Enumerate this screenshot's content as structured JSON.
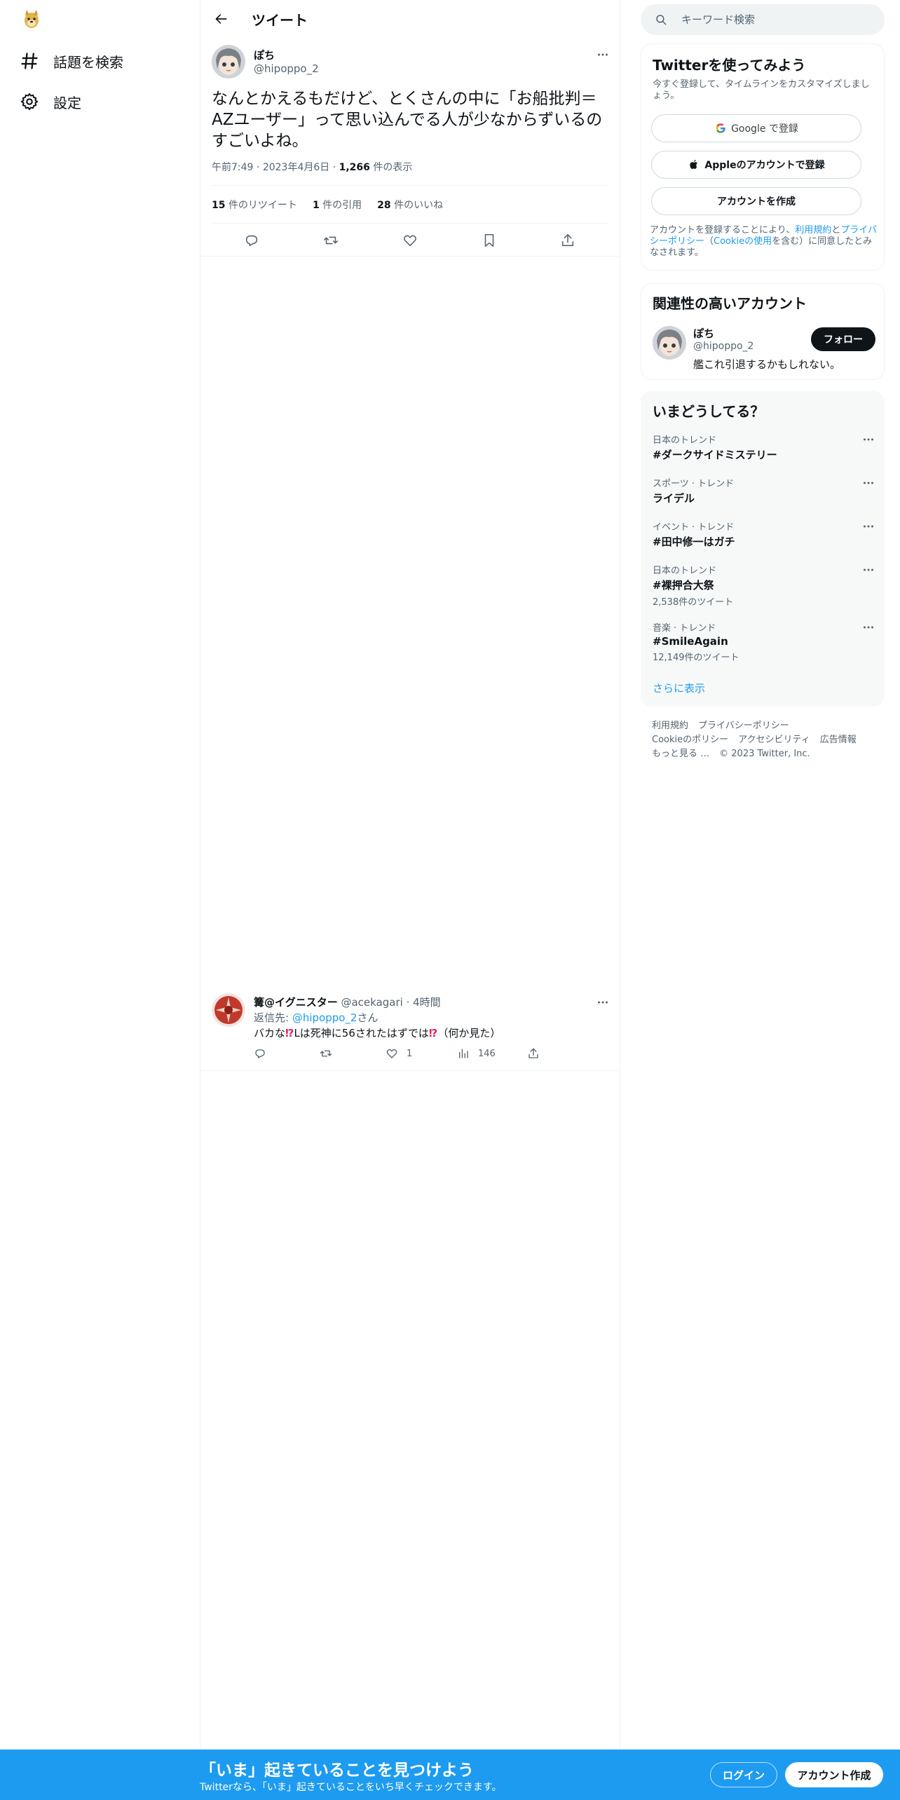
{
  "colors": {
    "accent": "#1d9bf0",
    "text_primary": "#0f1419",
    "text_secondary": "#536471",
    "border": "#eff3f4",
    "panel_bg": "#f7f9f9",
    "emoji_red": "#e0245e"
  },
  "nav": {
    "logo_icon": "doge-logo-icon",
    "items": [
      {
        "icon": "hashtag-icon",
        "label": "話題を検索"
      },
      {
        "icon": "gear-icon",
        "label": "設定"
      }
    ]
  },
  "header": {
    "title": "ツイート",
    "back_icon": "arrow-left-icon"
  },
  "tweet": {
    "name": "ぽち",
    "handle": "@hipoppo_2",
    "text": "なんとかえるもだけど、とくさんの中に「お船批判＝AZユーザー」って思い込んでる人が少なからずいるのすごいよね。",
    "time": "午前7:49",
    "date": "2023年4月6日",
    "views_count": "1,266",
    "views_label": "件の表示",
    "retweets_count": "15",
    "retweets_label": "件のリツイート",
    "quotes_count": "1",
    "quotes_label": "件の引用",
    "likes_count": "28",
    "likes_label": "件のいいね",
    "actions": [
      "reply-icon",
      "retweet-icon",
      "like-icon",
      "bookmark-icon",
      "share-icon"
    ]
  },
  "reply": {
    "name": "篝@イグニスター",
    "handle": "@acekagari",
    "time": "4時間",
    "reply_to_prefix": "返信先: ",
    "reply_to_handle": "@hipoppo_2",
    "reply_to_suffix": "さん",
    "text_a": "バカな",
    "text_emoji1": "⁉",
    "text_b": "Lは死神に56されたはずでは",
    "text_emoji2": "⁉",
    "text_c": "（何か見た）",
    "likes": "1",
    "views": "146"
  },
  "search": {
    "placeholder": "キーワード検索"
  },
  "signup_panel": {
    "title": "Twitterを使ってみよう",
    "subtitle": "今すぐ登録して、タイムラインをカスタマイズしましょう。",
    "google_label": "Google で登録",
    "apple_label": "Appleのアカウントで登録",
    "create_label": "アカウントを作成",
    "terms_a": "アカウントを登録することにより、",
    "terms_link1": "利用規約",
    "terms_b": "と",
    "terms_link2": "プライバシーポリシー",
    "terms_c": "（",
    "terms_link3": "Cookieの使用",
    "terms_d": "を含む）に同意したとみなされます。"
  },
  "related": {
    "title": "関連性の高いアカウント",
    "name": "ぽち",
    "handle": "@hipoppo_2",
    "bio": "艦これ引退するかもしれない。",
    "follow_label": "フォロー"
  },
  "trends": {
    "title": "いまどうしてる？",
    "items": [
      {
        "category": "日本のトレンド",
        "name": "#ダークサイドミステリー",
        "count": ""
      },
      {
        "category": "スポーツ · トレンド",
        "name": "ライデル",
        "count": ""
      },
      {
        "category": "イベント · トレンド",
        "name": "#田中修一はガチ",
        "count": ""
      },
      {
        "category": "日本のトレンド",
        "name": "#裸押合大祭",
        "count": "2,538件のツイート"
      },
      {
        "category": "音楽 · トレンド",
        "name": "#SmileAgain",
        "count": "12,149件のツイート"
      }
    ],
    "show_more": "さらに表示"
  },
  "footer": {
    "links": [
      "利用規約",
      "プライバシーポリシー",
      "Cookieのポリシー",
      "アクセシビリティ",
      "広告情報",
      "もっと見る …"
    ],
    "copyright": "© 2023 Twitter, Inc."
  },
  "bottom_bar": {
    "title": "「いま」起きていることを見つけよう",
    "subtitle": "Twitterなら、「いま」起きていることをいち早くチェックできます。",
    "login_label": "ログイン",
    "signup_label": "アカウント作成"
  }
}
